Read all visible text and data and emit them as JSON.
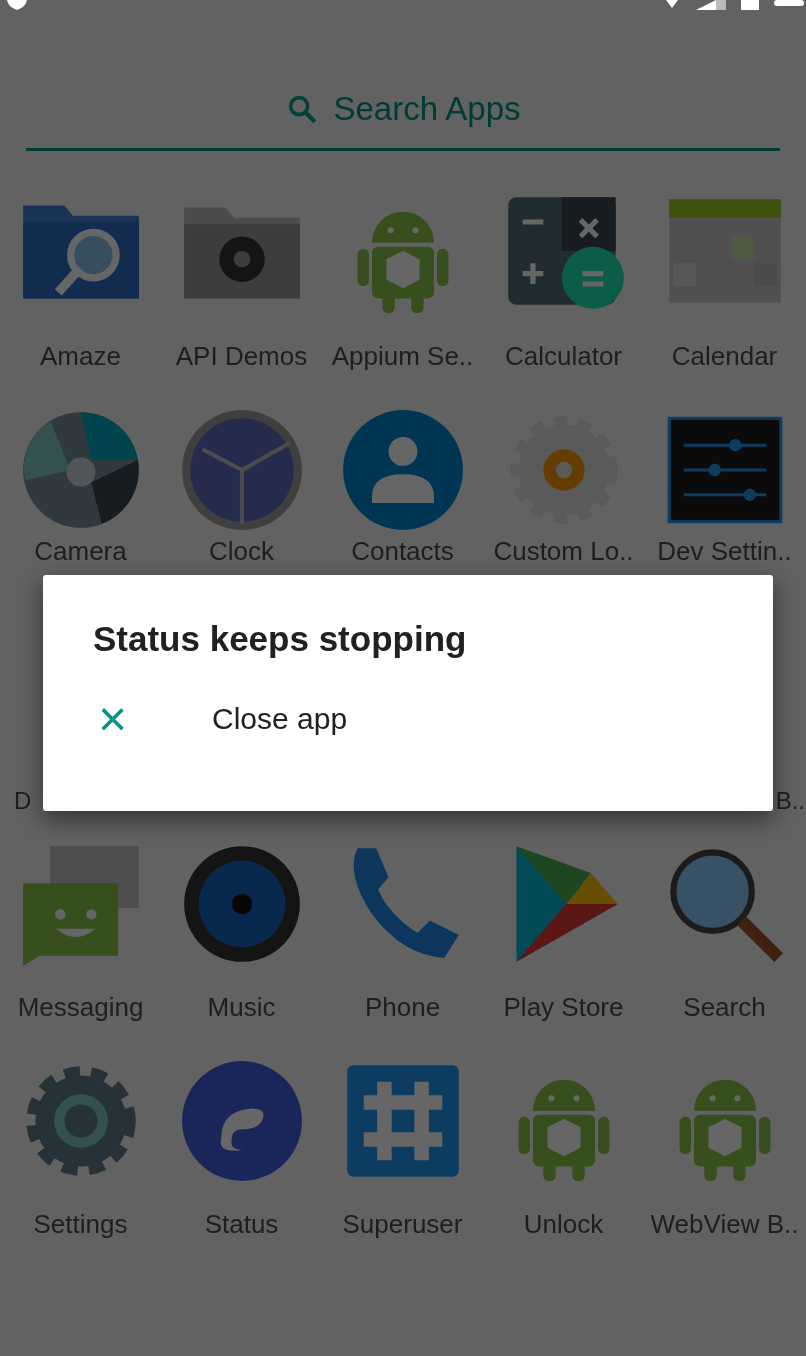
{
  "search": {
    "placeholder": "Search Apps"
  },
  "app_rows": [
    {
      "apps": [
        {
          "label": "Amaze",
          "kind": "folder-search"
        },
        {
          "label": "API Demos",
          "kind": "folder-gear"
        },
        {
          "label": "Appium Se..",
          "kind": "android"
        },
        {
          "label": "Calculator",
          "kind": "calculator"
        },
        {
          "label": "Calendar",
          "kind": "calendar"
        }
      ]
    },
    {
      "apps": [
        {
          "label": "Camera",
          "kind": "camera"
        },
        {
          "label": "Clock",
          "kind": "clock"
        },
        {
          "label": "Contacts",
          "kind": "contacts"
        },
        {
          "label": "Custom Lo..",
          "kind": "gear-orange"
        },
        {
          "label": "Dev Settin..",
          "kind": "sliders"
        }
      ]
    },
    {
      "apps": [
        {
          "label": "D",
          "kind": "hidden-left"
        },
        {
          "label": "B..",
          "kind": "hidden-right"
        }
      ]
    },
    {
      "apps": [
        {
          "label": "Messaging",
          "kind": "messaging"
        },
        {
          "label": "Music",
          "kind": "speaker"
        },
        {
          "label": "Phone",
          "kind": "phone"
        },
        {
          "label": "Play Store",
          "kind": "play"
        },
        {
          "label": "Search",
          "kind": "magnifier"
        }
      ]
    },
    {
      "apps": [
        {
          "label": "Settings",
          "kind": "settings"
        },
        {
          "label": "Status",
          "kind": "status"
        },
        {
          "label": "Superuser",
          "kind": "hash"
        },
        {
          "label": "Unlock",
          "kind": "android"
        },
        {
          "label": "WebView B..",
          "kind": "android"
        }
      ]
    }
  ],
  "dialog": {
    "title": "Status keeps stopping",
    "actions": [
      {
        "icon": "×",
        "label": "Close app"
      }
    ]
  }
}
